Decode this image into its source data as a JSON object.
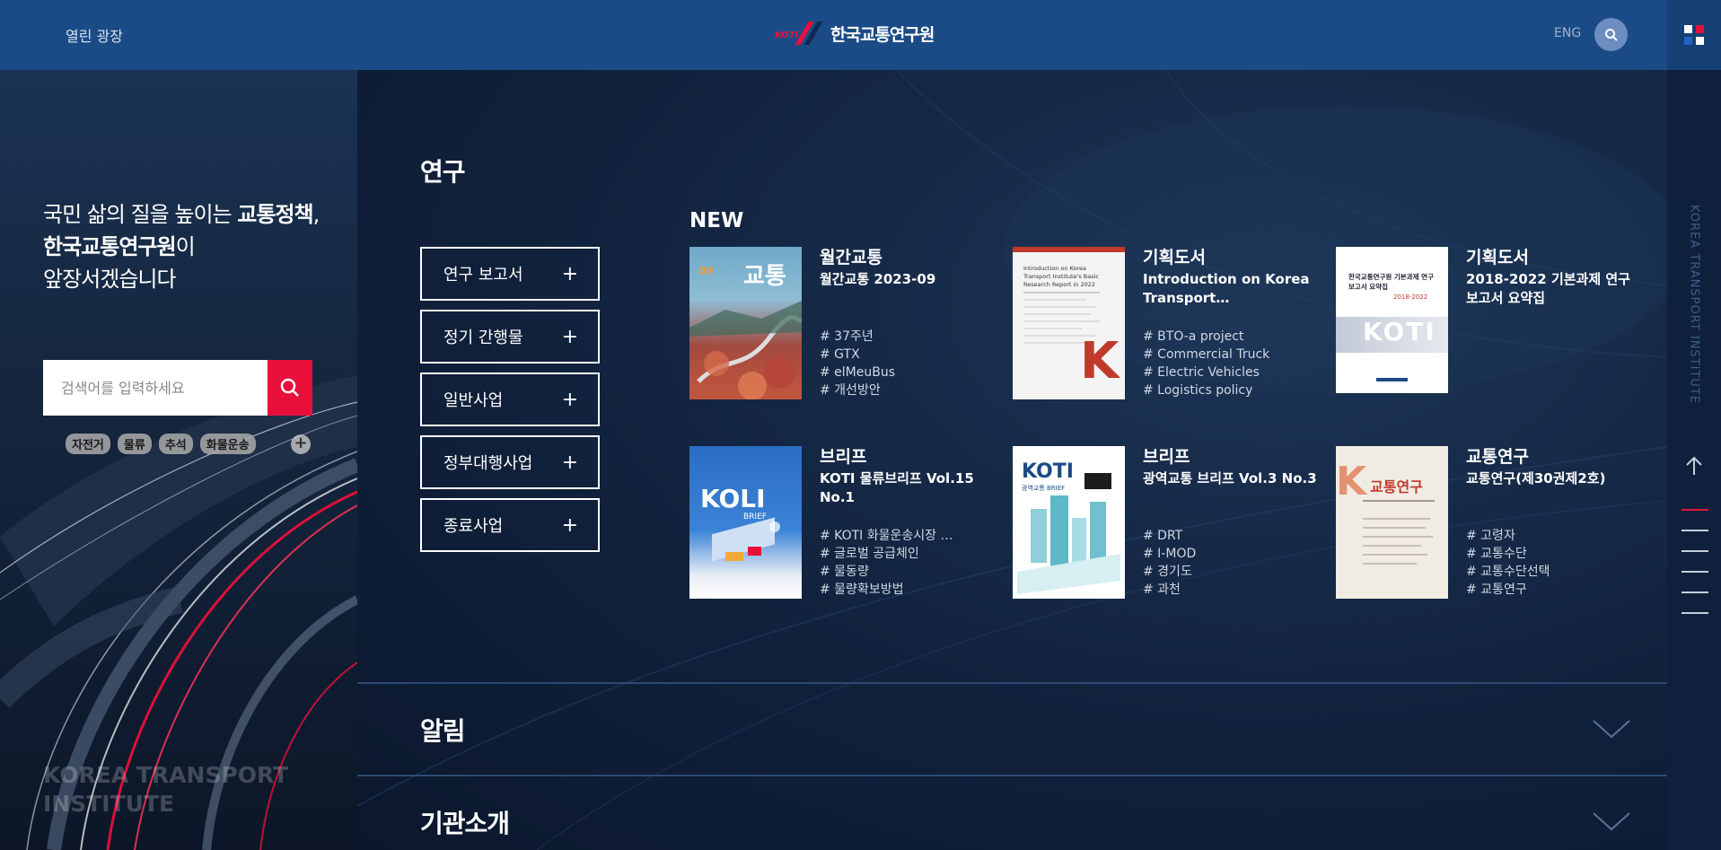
{
  "header": {
    "nav_link": "열린 광장",
    "logo_mark_text": "KOTI",
    "logo_text": "한국교통연구원",
    "lang_link": "ENG",
    "menu_colors": [
      "#ffffff",
      "#e8103a",
      "#1e64c8",
      "#ffffff"
    ]
  },
  "hero": {
    "slogan_line1_plain": "국민 삶의 질을 높이는 ",
    "slogan_line1_bold": "교통정책",
    "slogan_line1_end": ",",
    "slogan_line2_bold": "한국교통연구원",
    "slogan_line2_plain": "이",
    "slogan_line3": "앞장서겠습니다",
    "search_placeholder": "검색어를 입력하세요",
    "tags": [
      "자전거",
      "물류",
      "추석",
      "화물운송"
    ],
    "tag_more": "+",
    "background_text_line1": "KOREA TRANSPORT",
    "background_text_line2": "INSTITUTE"
  },
  "research": {
    "title": "연구",
    "categories": [
      {
        "label": "연구 보고서",
        "icon": "+"
      },
      {
        "label": "정기 간행물",
        "icon": "+"
      },
      {
        "label": "일반사업",
        "icon": "+"
      },
      {
        "label": "정부대행사업",
        "icon": "+"
      },
      {
        "label": "종료사업",
        "icon": "+"
      }
    ],
    "new_label": "NEW",
    "cards": [
      {
        "type": "월간교통",
        "title": "월간교통 2023-09",
        "tags": [
          "# 37주년",
          "# GTX",
          "# elMeuBus",
          "# 개선방안"
        ]
      },
      {
        "type": "기획도서",
        "title": "Introduction on Korea Transport…",
        "tags": [
          "# BTO-a project",
          "# Commercial Truck",
          "# Electric Vehicles",
          "# Logistics policy"
        ]
      },
      {
        "type": "기획도서",
        "title": "2018-2022 기본과제 연구보고서 요약집",
        "tags": []
      },
      {
        "type": "브리프",
        "title": "KOTI 물류브리프 Vol.15 No.1",
        "tags": [
          "# KOTI 화물운송시장 …",
          "# 글로벌 공급체인",
          "# 물동량",
          "# 물량확보방법"
        ]
      },
      {
        "type": "브리프",
        "title": "광역교통 브리프 Vol.3 No.3",
        "tags": [
          "# DRT",
          "# I-MOD",
          "# 경기도",
          "# 과천"
        ]
      },
      {
        "type": "교통연구",
        "title": "교통연구(제30권제2호)",
        "tags": [
          "# 고령자",
          "# 교통수단",
          "# 교통수단선택",
          "# 교통연구"
        ]
      }
    ],
    "cover_texts": {
      "c1_num": "09",
      "c1_big": "교통",
      "c2_title": "Introduction on Korea Transport Institute's Basic Research Report in 2022",
      "c2_letter": "K",
      "c3_title": "한국교통연구원 기본과제 연구보고서 요약집",
      "c3_years": "2018-2022",
      "c3_logo": "KOTI",
      "c4_logo": "KOLI",
      "c4_sub": "BRIEF",
      "c5_logo": "KOTI",
      "c5_sub": "광역교통 BRIEF",
      "c6_title": "교통연구",
      "c6_letter": "K"
    }
  },
  "notice": {
    "title": "알림"
  },
  "about": {
    "title": "기관소개"
  },
  "rail": {
    "vertical_text": "KOREA TRANSPORT INSTITUTE"
  }
}
